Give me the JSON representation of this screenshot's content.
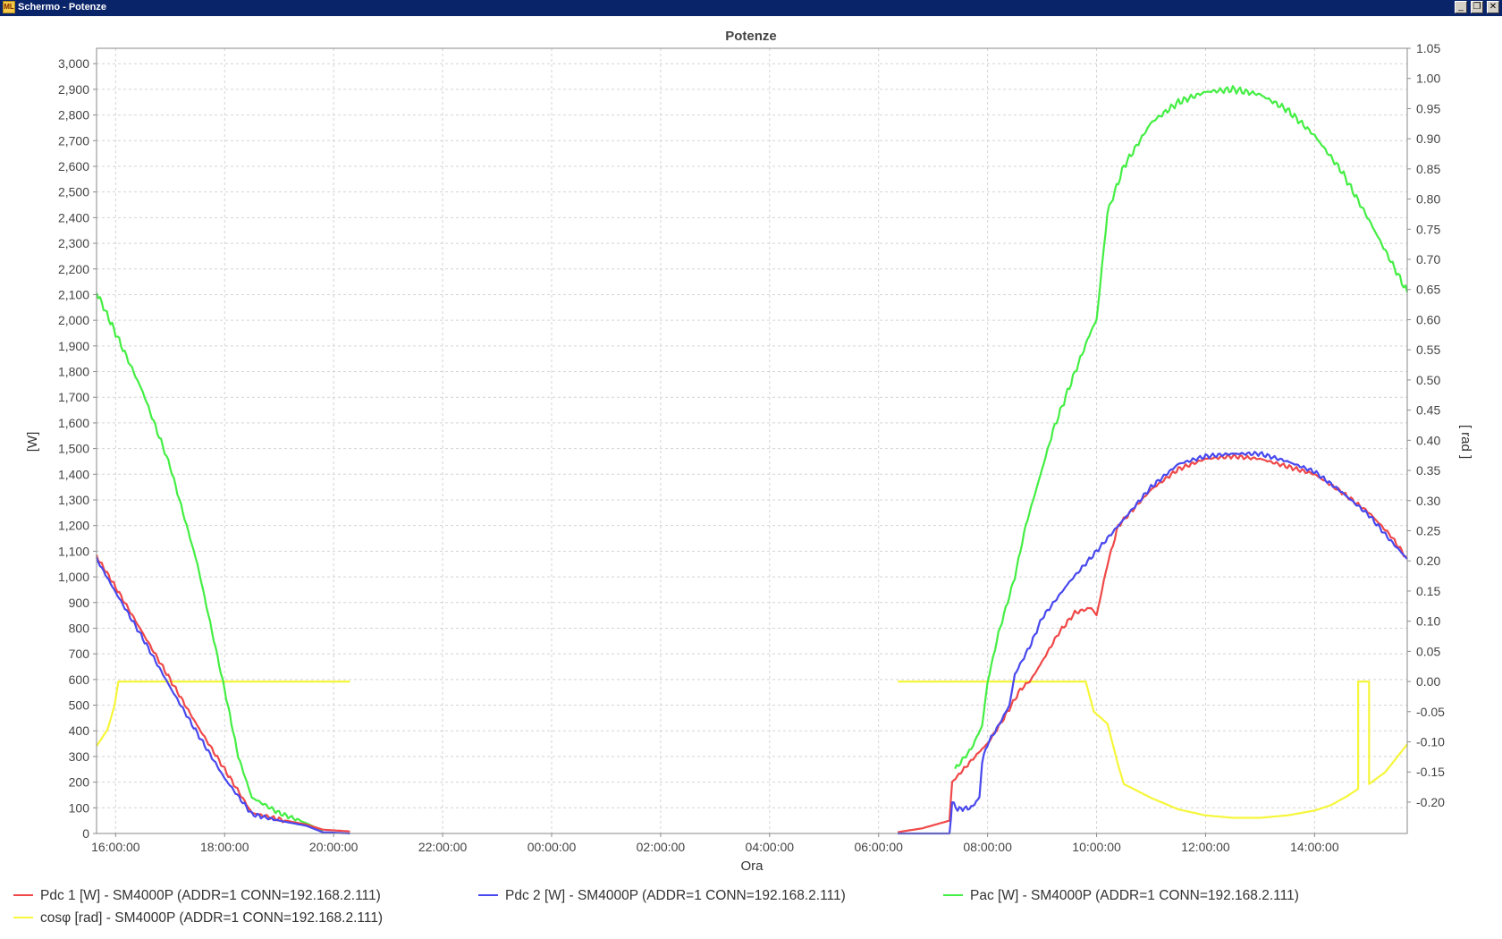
{
  "window": {
    "title": "Schermo - Potenze",
    "icon": "app-icon",
    "buttons": [
      "minimize-icon",
      "restore-icon",
      "close-icon"
    ]
  },
  "colors": {
    "pdc1": "#f04848",
    "pdc2": "#4848ee",
    "pac": "#44ee44",
    "cosphi": "#f6f63a",
    "grid": "#d4d4d4",
    "titlebar": "#0a246a"
  },
  "chart_data": {
    "type": "line",
    "title": "Potenze",
    "xlabel": "Ora",
    "ylabel": "[W]",
    "y2label": "[ rad ]",
    "x_ticks": [
      "16:00:00",
      "18:00:00",
      "20:00:00",
      "22:00:00",
      "00:00:00",
      "02:00:00",
      "04:00:00",
      "06:00:00",
      "08:00:00",
      "10:00:00",
      "12:00:00",
      "14:00:00"
    ],
    "x_range_hours": [
      15.65,
      39.7
    ],
    "x_axis_note": "hours counted from midnight of day 1; values > 24 are next day",
    "ylim": [
      0,
      3060
    ],
    "y_ticks": [
      0,
      100,
      200,
      300,
      400,
      500,
      600,
      700,
      800,
      900,
      1000,
      1100,
      1200,
      1300,
      1400,
      1500,
      1600,
      1700,
      1800,
      1900,
      2000,
      2100,
      2200,
      2300,
      2400,
      2500,
      2600,
      2700,
      2800,
      2900,
      3000
    ],
    "y_tick_labels": [
      "0",
      "100",
      "200",
      "300",
      "400",
      "500",
      "600",
      "700",
      "800",
      "900",
      "1,000",
      "1,100",
      "1,200",
      "1,300",
      "1,400",
      "1,500",
      "1,600",
      "1,700",
      "1,800",
      "1,900",
      "2,000",
      "2,100",
      "2,200",
      "2,300",
      "2,400",
      "2,500",
      "2,600",
      "2,700",
      "2,800",
      "2,900",
      "3,000"
    ],
    "y2lim": [
      -0.252,
      1.05
    ],
    "y2_ticks": [
      -0.2,
      -0.15,
      -0.1,
      -0.05,
      0.0,
      0.05,
      0.1,
      0.15,
      0.2,
      0.25,
      0.3,
      0.35,
      0.4,
      0.45,
      0.5,
      0.55,
      0.6,
      0.65,
      0.7,
      0.75,
      0.8,
      0.85,
      0.9,
      0.95,
      1.0,
      1.05
    ],
    "y2_tick_labels": [
      "-0.20",
      "-0.15",
      "-0.10",
      "-0.05",
      "0.00",
      "0.05",
      "0.10",
      "0.15",
      "0.20",
      "0.25",
      "0.30",
      "0.35",
      "0.40",
      "0.45",
      "0.50",
      "0.55",
      "0.60",
      "0.65",
      "0.70",
      "0.75",
      "0.80",
      "0.85",
      "0.90",
      "0.95",
      "1.00",
      "1.05"
    ],
    "grid": true,
    "legend_position": "bottom",
    "series": [
      {
        "name": "Pdc  1 [W] - SM4000P (ADDR=1 CONN=192.168.2.111)",
        "axis": "left",
        "color_key": "pdc1",
        "segments": [
          [
            [
              15.65,
              1080
            ],
            [
              16.0,
              960
            ],
            [
              16.5,
              780
            ],
            [
              17.0,
              600
            ],
            [
              17.5,
              420
            ],
            [
              18.0,
              250
            ],
            [
              18.5,
              80
            ],
            [
              19.0,
              55
            ],
            [
              19.5,
              35
            ],
            [
              19.8,
              15
            ],
            [
              20.3,
              8
            ]
          ],
          [
            [
              30.35,
              5
            ],
            [
              30.8,
              20
            ],
            [
              31.3,
              50
            ],
            [
              31.35,
              200
            ],
            [
              31.6,
              260
            ],
            [
              31.9,
              330
            ],
            [
              32.0,
              350
            ],
            [
              32.3,
              450
            ],
            [
              32.6,
              560
            ],
            [
              32.8,
              600
            ],
            [
              33.0,
              670
            ],
            [
              33.3,
              780
            ],
            [
              33.6,
              860
            ],
            [
              33.9,
              880
            ],
            [
              34.0,
              850
            ],
            [
              34.2,
              1050
            ],
            [
              34.4,
              1200
            ],
            [
              35.0,
              1340
            ],
            [
              35.5,
              1420
            ],
            [
              36.0,
              1460
            ],
            [
              36.5,
              1470
            ],
            [
              37.0,
              1460
            ],
            [
              37.5,
              1430
            ],
            [
              38.0,
              1400
            ],
            [
              38.5,
              1330
            ],
            [
              39.0,
              1250
            ],
            [
              39.4,
              1160
            ],
            [
              39.7,
              1070
            ]
          ]
        ]
      },
      {
        "name": "Pdc  2 [W] - SM4000P (ADDR=1 CONN=192.168.2.111)",
        "axis": "left",
        "color_key": "pdc2",
        "segments": [
          [
            [
              15.65,
              1070
            ],
            [
              16.0,
              940
            ],
            [
              16.5,
              760
            ],
            [
              17.0,
              570
            ],
            [
              17.5,
              390
            ],
            [
              18.0,
              215
            ],
            [
              18.5,
              75
            ],
            [
              19.0,
              50
            ],
            [
              19.5,
              30
            ],
            [
              19.8,
              5
            ],
            [
              20.3,
              0
            ]
          ],
          [
            [
              30.35,
              0
            ],
            [
              31.3,
              0
            ],
            [
              31.35,
              120
            ],
            [
              31.45,
              95
            ],
            [
              31.7,
              100
            ],
            [
              31.85,
              140
            ],
            [
              31.9,
              280
            ],
            [
              32.0,
              350
            ],
            [
              32.2,
              420
            ],
            [
              32.4,
              500
            ],
            [
              32.5,
              620
            ],
            [
              32.8,
              740
            ],
            [
              33.0,
              840
            ],
            [
              33.5,
              980
            ],
            [
              34.0,
              1100
            ],
            [
              34.4,
              1200
            ],
            [
              35.0,
              1350
            ],
            [
              35.5,
              1440
            ],
            [
              36.0,
              1470
            ],
            [
              36.5,
              1480
            ],
            [
              37.0,
              1480
            ],
            [
              37.5,
              1450
            ],
            [
              38.0,
              1410
            ],
            [
              38.5,
              1330
            ],
            [
              39.0,
              1240
            ],
            [
              39.4,
              1140
            ],
            [
              39.7,
              1070
            ]
          ]
        ]
      },
      {
        "name": "Pac [W] - SM4000P (ADDR=1 CONN=192.168.2.111)",
        "axis": "left",
        "color_key": "pac",
        "segments": [
          [
            [
              15.65,
              2110
            ],
            [
              16.0,
              1950
            ],
            [
              16.5,
              1720
            ],
            [
              17.0,
              1430
            ],
            [
              17.5,
              1050
            ],
            [
              18.0,
              560
            ],
            [
              18.25,
              300
            ],
            [
              18.5,
              140
            ],
            [
              19.0,
              80
            ],
            [
              19.5,
              40
            ],
            [
              19.8,
              10
            ]
          ],
          [
            [
              31.4,
              250
            ],
            [
              31.7,
              330
            ],
            [
              31.9,
              420
            ],
            [
              32.0,
              590
            ],
            [
              32.2,
              780
            ],
            [
              32.5,
              1000
            ],
            [
              32.7,
              1200
            ],
            [
              33.0,
              1420
            ],
            [
              33.2,
              1570
            ],
            [
              33.5,
              1740
            ],
            [
              33.9,
              1960
            ],
            [
              34.0,
              2000
            ],
            [
              34.2,
              2420
            ],
            [
              34.5,
              2600
            ],
            [
              35.0,
              2770
            ],
            [
              35.5,
              2850
            ],
            [
              36.0,
              2890
            ],
            [
              36.5,
              2900
            ],
            [
              37.0,
              2880
            ],
            [
              37.5,
              2820
            ],
            [
              38.0,
              2720
            ],
            [
              38.5,
              2580
            ],
            [
              39.0,
              2390
            ],
            [
              39.4,
              2230
            ],
            [
              39.7,
              2110
            ]
          ]
        ]
      },
      {
        "name": "cosφ [rad] - SM4000P (ADDR=1 CONN=192.168.2.111)",
        "axis": "right",
        "color_key": "cosphi",
        "segments": [
          [
            [
              15.65,
              -0.107
            ],
            [
              15.85,
              -0.08
            ],
            [
              15.98,
              -0.04
            ],
            [
              16.05,
              0.0
            ],
            [
              20.3,
              0.0
            ]
          ],
          [
            [
              30.35,
              0.0
            ],
            [
              33.8,
              0.0
            ],
            [
              33.95,
              -0.05
            ],
            [
              34.2,
              -0.07
            ],
            [
              34.4,
              -0.14
            ],
            [
              34.5,
              -0.17
            ],
            [
              35.0,
              -0.193
            ],
            [
              35.5,
              -0.212
            ],
            [
              36.0,
              -0.222
            ],
            [
              36.5,
              -0.226
            ],
            [
              37.0,
              -0.226
            ],
            [
              37.5,
              -0.222
            ],
            [
              38.0,
              -0.214
            ],
            [
              38.3,
              -0.205
            ],
            [
              38.6,
              -0.19
            ],
            [
              38.8,
              -0.178
            ],
            [
              38.8,
              0.0
            ],
            [
              39.0,
              0.0
            ],
            [
              39.0,
              -0.17
            ],
            [
              39.3,
              -0.15
            ],
            [
              39.7,
              -0.104
            ]
          ]
        ]
      }
    ]
  },
  "legend": {
    "pdc1": "Pdc  1 [W] - SM4000P (ADDR=1 CONN=192.168.2.111)",
    "pdc2": "Pdc  2 [W] - SM4000P (ADDR=1 CONN=192.168.2.111)",
    "pac": "Pac [W] - SM4000P (ADDR=1 CONN=192.168.2.111)",
    "cosphi": "cosφ [rad] - SM4000P (ADDR=1 CONN=192.168.2.111)"
  }
}
